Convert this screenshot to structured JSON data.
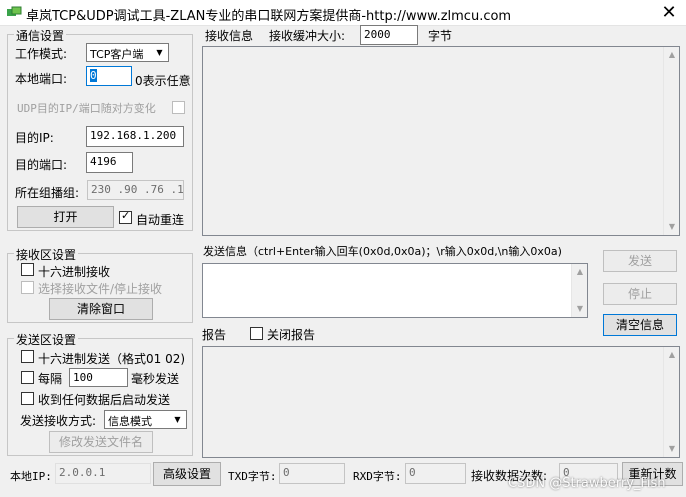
{
  "window": {
    "title": "卓岚TCP&UDP调试工具-ZLAN专业的串口联网方案提供商-http://www.zlmcu.com",
    "close_glyph": "✕"
  },
  "comm": {
    "legend": "通信设置",
    "mode_label": "工作模式:",
    "mode_value": "TCP客户端",
    "local_port_label": "本地端口:",
    "local_port_value": "0",
    "local_port_hint": "0表示任意",
    "random_dest_label": "UDP目的IP/端口随对方变化",
    "dest_ip_label": "目的IP:",
    "dest_ip_value": "192.168.1.200",
    "dest_port_label": "目的端口:",
    "dest_port_value": "4196",
    "multicast_label": "所在组播组:",
    "multicast_value": "230 .90 .76 .1",
    "open_button": "打开",
    "auto_reconnect_label": "自动重连",
    "auto_reconnect_checked": true
  },
  "recv_settings": {
    "legend": "接收区设置",
    "hex_recv_label": "十六进制接收",
    "recv_file_label": "选择接收文件/停止接收",
    "clear_button": "清除窗口"
  },
  "send_settings": {
    "legend": "发送区设置",
    "hex_send_label": "十六进制发送（格式01 02)",
    "every_label": "每隔",
    "every_value": "100",
    "ms_send_label": "毫秒发送",
    "send_on_recv_label": "收到任何数据后启动发送",
    "send_mode_label": "发送接收方式:",
    "send_mode_value": "信息模式",
    "modify_file_button": "修改发送文件名"
  },
  "recv_panel": {
    "label": "接收信息",
    "buffer_label": "接收缓冲大小:",
    "buffer_value": "2000",
    "buffer_unit": "字节"
  },
  "send_panel": {
    "label": "发送信息（ctrl+Enter输入回车(0x0d,0x0a)；\\r输入0x0d,\\n输入0x0a)",
    "send_button": "发送",
    "stop_button": "停止",
    "clear_info_button": "清空信息"
  },
  "report": {
    "label": "报告",
    "close_report_label": "关闭报告"
  },
  "status": {
    "local_ip_label": "本地IP:",
    "local_ip_value": "2.0.0.1",
    "advanced_button": "高级设置",
    "txd_label": "TXD字节:",
    "txd_value": "0",
    "rxd_label": "RXD字节:",
    "rxd_value": "0",
    "recv_count_label": "接收数据次数:",
    "recv_count_value": "0",
    "reset_count_button": "重新计数",
    "watermark": "CSDN @Strawberry_Fish"
  },
  "colors": {
    "app_icon": "#3aa34a",
    "focus_border": "#0078d7",
    "selection": "#0078d7"
  }
}
